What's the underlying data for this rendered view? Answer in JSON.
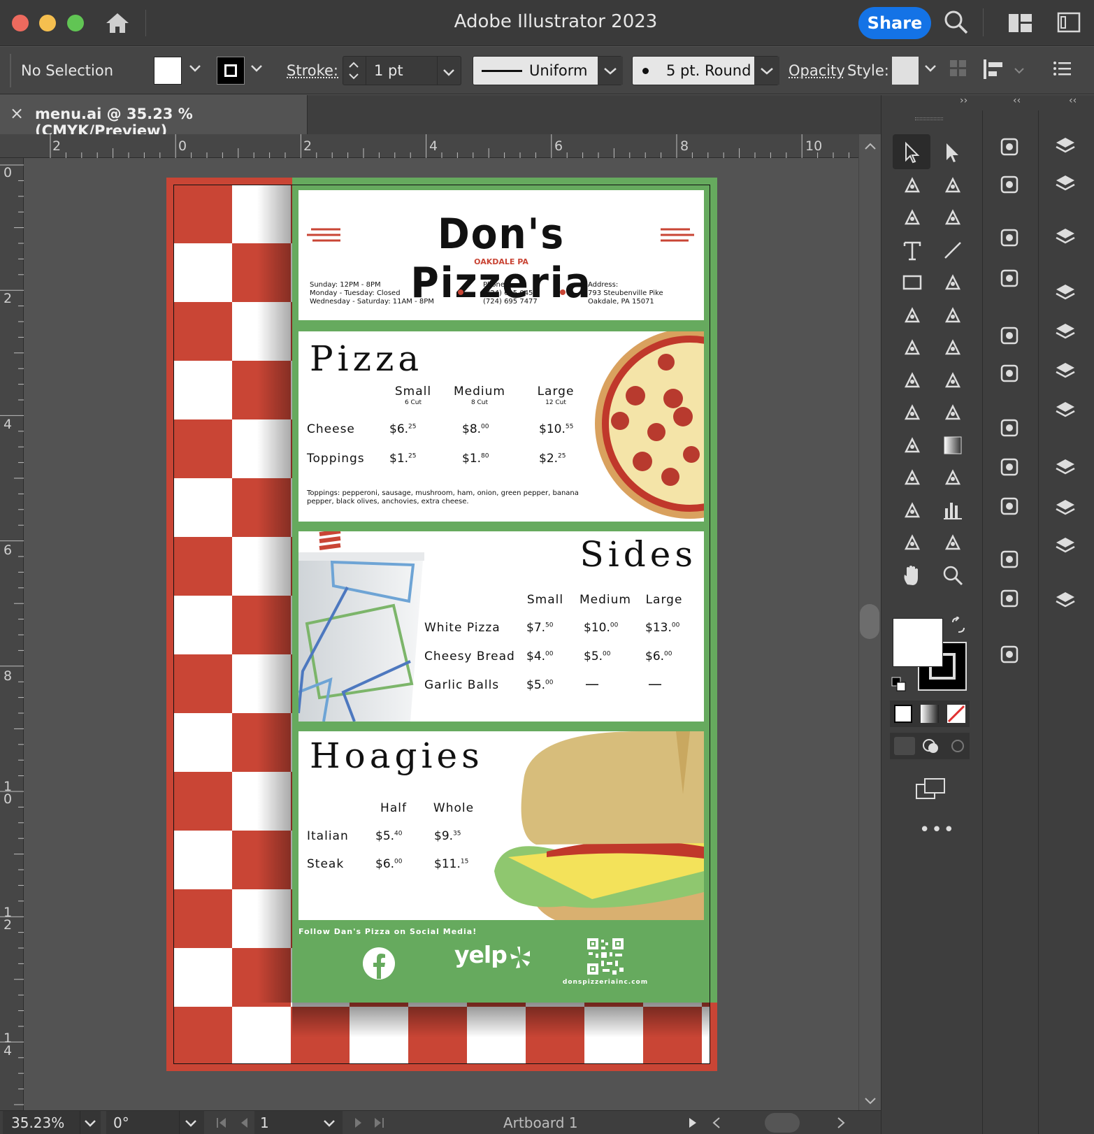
{
  "window": {
    "title": "Adobe Illustrator 2023",
    "share_label": "Share"
  },
  "control_bar": {
    "selection": "No Selection",
    "stroke_label": "Stroke:",
    "stroke_weight": "1 pt",
    "profile": "Uniform",
    "brush": "5 pt. Round",
    "opacity_label": "Opacity",
    "style_label": "Style:"
  },
  "document_tab": {
    "close_glyph": "×",
    "title": "menu.ai @ 35.23 % (CMYK/Preview)"
  },
  "rulers": {
    "horizontal": [
      "2",
      "0",
      "2",
      "4",
      "6",
      "8",
      "10"
    ],
    "vertical": [
      "0",
      "2",
      "4",
      "6",
      "8",
      "1 0",
      "1 2",
      "1 4"
    ]
  },
  "status_bar": {
    "zoom": "35.23%",
    "rotation": "0°",
    "artboard_number": "1",
    "artboard_name": "Artboard 1"
  },
  "menu": {
    "name": "Don's Pizzeria",
    "location": "OAKDALE PA",
    "hours_lines": [
      "Sunday: 12PM - 8PM",
      "Monday - Tuesday: Closed",
      "Wednesday - Saturday: 11AM - 8PM"
    ],
    "phone_lines": [
      "Phone:",
      "(724) 695 0454",
      "(724) 695 7477"
    ],
    "address_lines": [
      "Address:",
      "793 Steubenville Pike",
      "Oakdale, PA 15071"
    ],
    "pizza": {
      "title": "Pizza",
      "sizes": [
        {
          "name": "Small",
          "cut": "6 Cut"
        },
        {
          "name": "Medium",
          "cut": "8 Cut"
        },
        {
          "name": "Large",
          "cut": "12 Cut"
        }
      ],
      "rows": [
        {
          "item": "Cheese",
          "prices": [
            {
              "d": "$6.",
              "c": "25"
            },
            {
              "d": "$8.",
              "c": "00"
            },
            {
              "d": "$10.",
              "c": "55"
            }
          ]
        },
        {
          "item": "Toppings",
          "prices": [
            {
              "d": "$1.",
              "c": "25"
            },
            {
              "d": "$1.",
              "c": "80"
            },
            {
              "d": "$2.",
              "c": "25"
            }
          ]
        }
      ],
      "toppings_note": "Toppings: pepperoni, sausage, mushroom, ham, onion, green pepper, banana pepper, black olives, anchovies, extra cheese."
    },
    "sides": {
      "title": "Sides",
      "sizes": [
        "Small",
        "Medium",
        "Large"
      ],
      "rows": [
        {
          "item": "White Pizza",
          "prices": [
            {
              "d": "$7.",
              "c": "50"
            },
            {
              "d": "$10.",
              "c": "00"
            },
            {
              "d": "$13.",
              "c": "00"
            }
          ]
        },
        {
          "item": "Cheesy Bread",
          "prices": [
            {
              "d": "$4.",
              "c": "00"
            },
            {
              "d": "$5.",
              "c": "00"
            },
            {
              "d": "$6.",
              "c": "00"
            }
          ]
        },
        {
          "item": "Garlic Balls",
          "prices": [
            {
              "d": "$5.",
              "c": "00"
            },
            {
              "d": "—",
              "c": ""
            },
            {
              "d": "—",
              "c": ""
            }
          ]
        }
      ]
    },
    "hoagies": {
      "title": "Hoagies",
      "sizes": [
        "Half",
        "Whole"
      ],
      "rows": [
        {
          "item": "Italian",
          "prices": [
            {
              "d": "$5.",
              "c": "40"
            },
            {
              "d": "$9.",
              "c": "35"
            }
          ]
        },
        {
          "item": "Steak",
          "prices": [
            {
              "d": "$6.",
              "c": "00"
            },
            {
              "d": "$11.",
              "c": "15"
            }
          ]
        }
      ]
    },
    "footer": {
      "follow": "Follow Dan's Pizza on Social Media!",
      "yelp": "yelp",
      "website": "donspizzeriainc.com"
    }
  },
  "colors": {
    "accent": "#1473e6",
    "menu_red": "#c94535",
    "menu_green": "#66aa5e",
    "ui_dark": "#3e3e3e"
  }
}
